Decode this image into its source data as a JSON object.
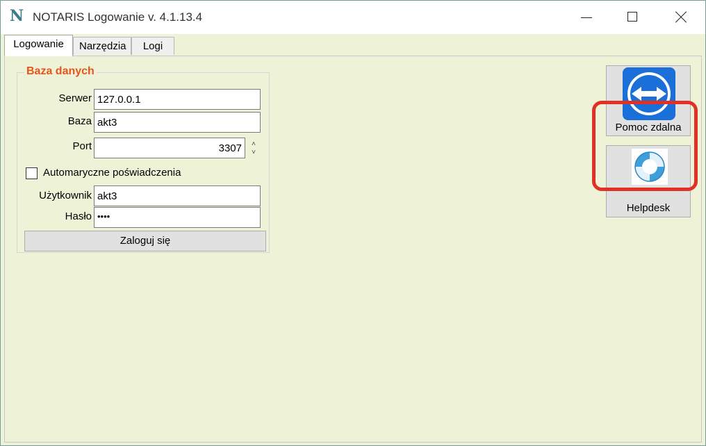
{
  "window": {
    "logo": "N",
    "title": "NOTARIS Logowanie v. 4.1.13.4"
  },
  "tabs": [
    {
      "label": "Logowanie",
      "active": true
    },
    {
      "label": "Narzędzia",
      "active": false
    },
    {
      "label": "Logi",
      "active": false
    }
  ],
  "database": {
    "group_title": "Baza danych",
    "server_label": "Serwer",
    "server_value": "127.0.0.1",
    "db_label": "Baza",
    "db_value": "akt3",
    "port_label": "Port",
    "port_value": "3307",
    "auto_credentials_label": "Automaryczne poświadczenia",
    "auto_credentials_checked": false,
    "user_label": "Użytkownik",
    "user_value": "akt3",
    "password_label": "Hasło",
    "password_value": "••••",
    "login_button": "Zaloguj się"
  },
  "side_buttons": {
    "remote_help": "Pomoc zdalna",
    "helpdesk": "Helpdesk"
  },
  "colors": {
    "background": "#eef2d6",
    "group_title": "#e8541c",
    "highlight": "#e03124",
    "teamviewer_blue": "#1a6fd9"
  },
  "icons": {
    "logo": "notaris-logo-icon",
    "remote": "teamviewer-icon",
    "helpdesk": "lifebuoy-icon"
  }
}
